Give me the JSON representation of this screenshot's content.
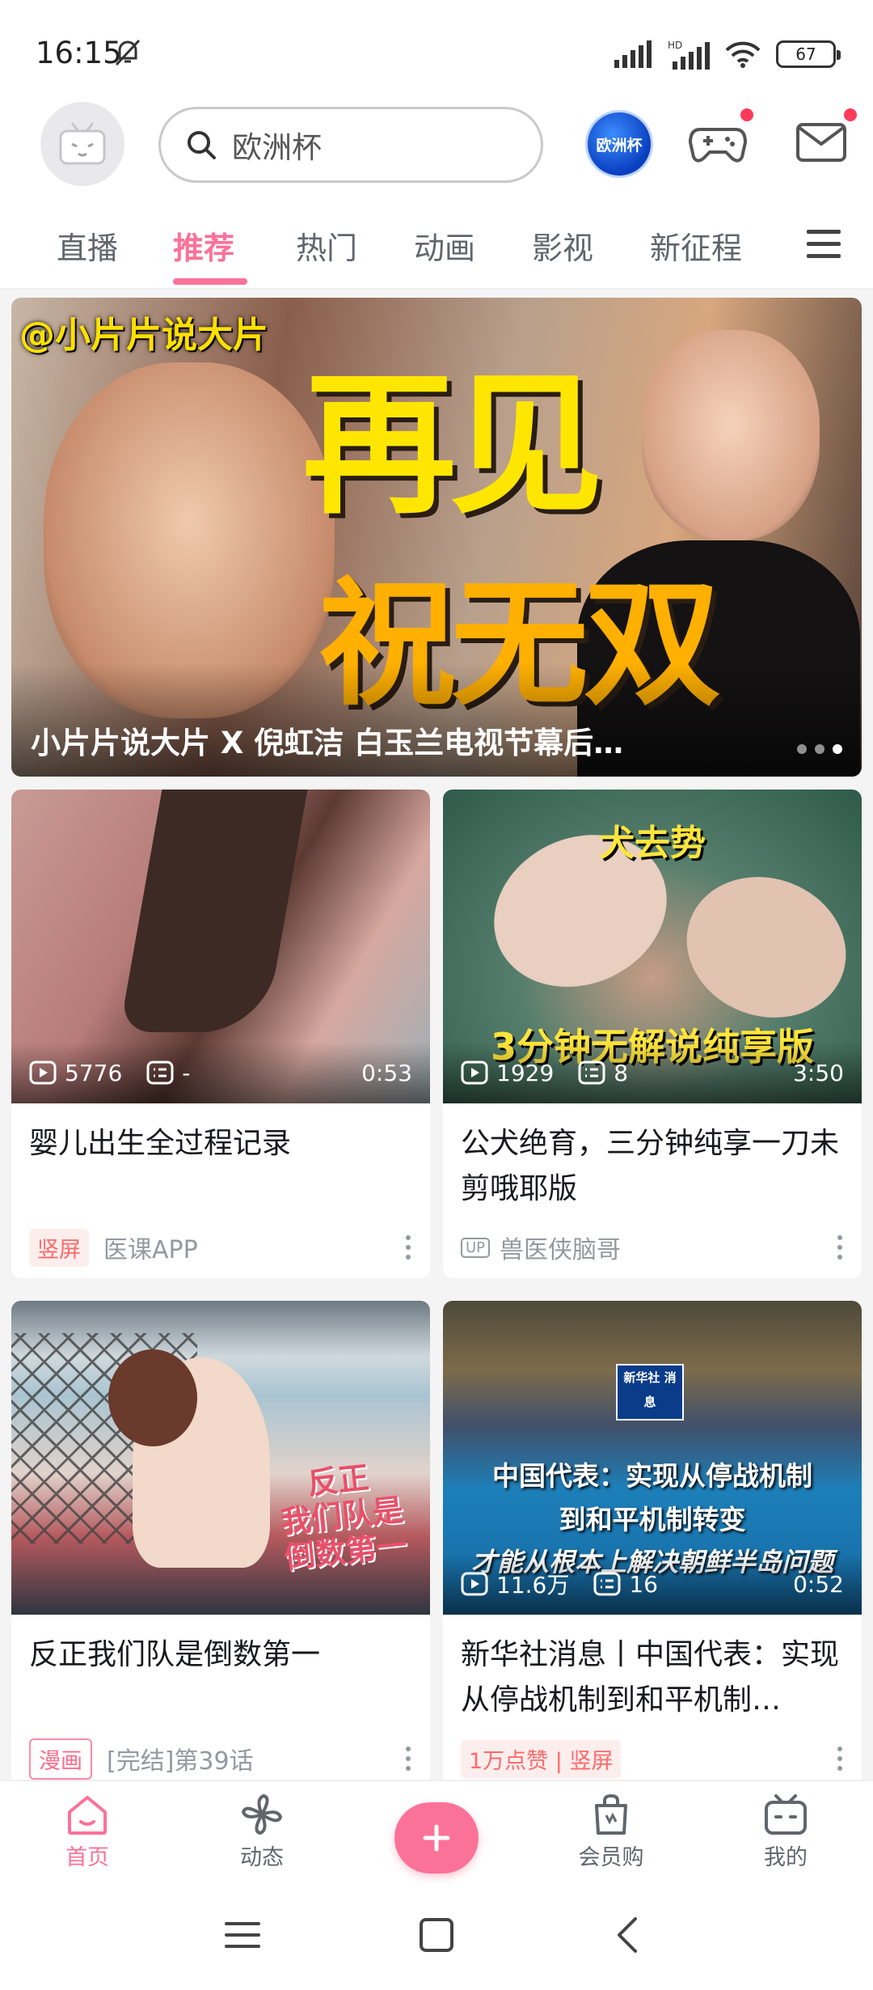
{
  "status_bar": {
    "time": "16:15",
    "battery": "67"
  },
  "header": {
    "search_placeholder": "欧洲杯",
    "euro_badge": "欧洲杯"
  },
  "tabs": [
    "直播",
    "推荐",
    "热门",
    "动画",
    "影视",
    "新征程"
  ],
  "banner": {
    "watermark": "@小片片说大片",
    "big_line1": "再见",
    "big_line2": "祝无双",
    "title": "小片片说大片 X 倪虹洁 白玉兰电视节幕后…"
  },
  "cards": [
    {
      "views": "5776",
      "danmaku": "-",
      "duration": "0:53",
      "title": "婴儿出生全过程记录",
      "badge": "竖屏",
      "author": "医课APP",
      "overlay_top": "",
      "overlay_bottom": ""
    },
    {
      "views": "1929",
      "danmaku": "8",
      "duration": "3:50",
      "title": "公犬绝育，三分钟纯享一刀未剪哦耶版",
      "badge": "",
      "author": "兽医侠脑哥",
      "overlay_top": "犬去势",
      "overlay_bottom": "3分钟无解说纯享版"
    },
    {
      "views": "",
      "danmaku": "",
      "duration": "",
      "title": "反正我们队是倒数第一",
      "badge": "漫画",
      "author": "[完结]第39话",
      "overlay_top": "",
      "overlay_bottom": "反正\n我们队是\n倒数第一"
    },
    {
      "views": "11.6万",
      "danmaku": "16",
      "duration": "0:52",
      "title": "新华社消息丨中国代表：实现从停战机制到和平机制…",
      "badge": "1万点赞 | 竖屏",
      "author": "",
      "overlay_top": "中国代表：实现从停战机制",
      "overlay_mid": "到和平机制转变",
      "overlay_bottom": "才能从根本上解决朝鲜半岛问题",
      "logo": "新华社 消息"
    }
  ],
  "bottom_nav": {
    "home": "首页",
    "dynamic": "动态",
    "vip": "会员购",
    "mine": "我的"
  },
  "colors": {
    "accent": "#fb7299"
  }
}
